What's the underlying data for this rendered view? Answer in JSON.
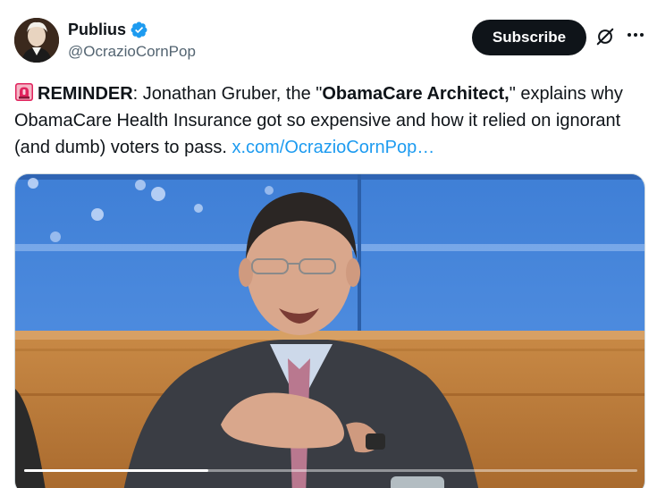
{
  "author": {
    "display_name": "Publius",
    "handle": "@OcrazioCornPop",
    "verified": true,
    "avatar_icon": "portrait-avatar"
  },
  "actions": {
    "subscribe_label": "Subscribe",
    "grok_icon": "grok-icon",
    "more_icon": "more-icon"
  },
  "tweet": {
    "emoji": "siren-icon",
    "reminder": "REMINDER",
    "text_1": ": Jonathan Gruber, the \"",
    "bold_1": "ObamaCare Architect,",
    "text_2": "\" explains why ObamaCare Health Insurance got so expensive and how it relied on ignorant (and dumb) voters to pass. ",
    "link": "x.com/OcrazioCornPop…"
  },
  "video": {
    "progress": 0.3
  },
  "colors": {
    "link": "#1d9bf0",
    "verified": "#1d9bf0",
    "button_bg": "#0f1419",
    "secondary_text": "#536471"
  }
}
